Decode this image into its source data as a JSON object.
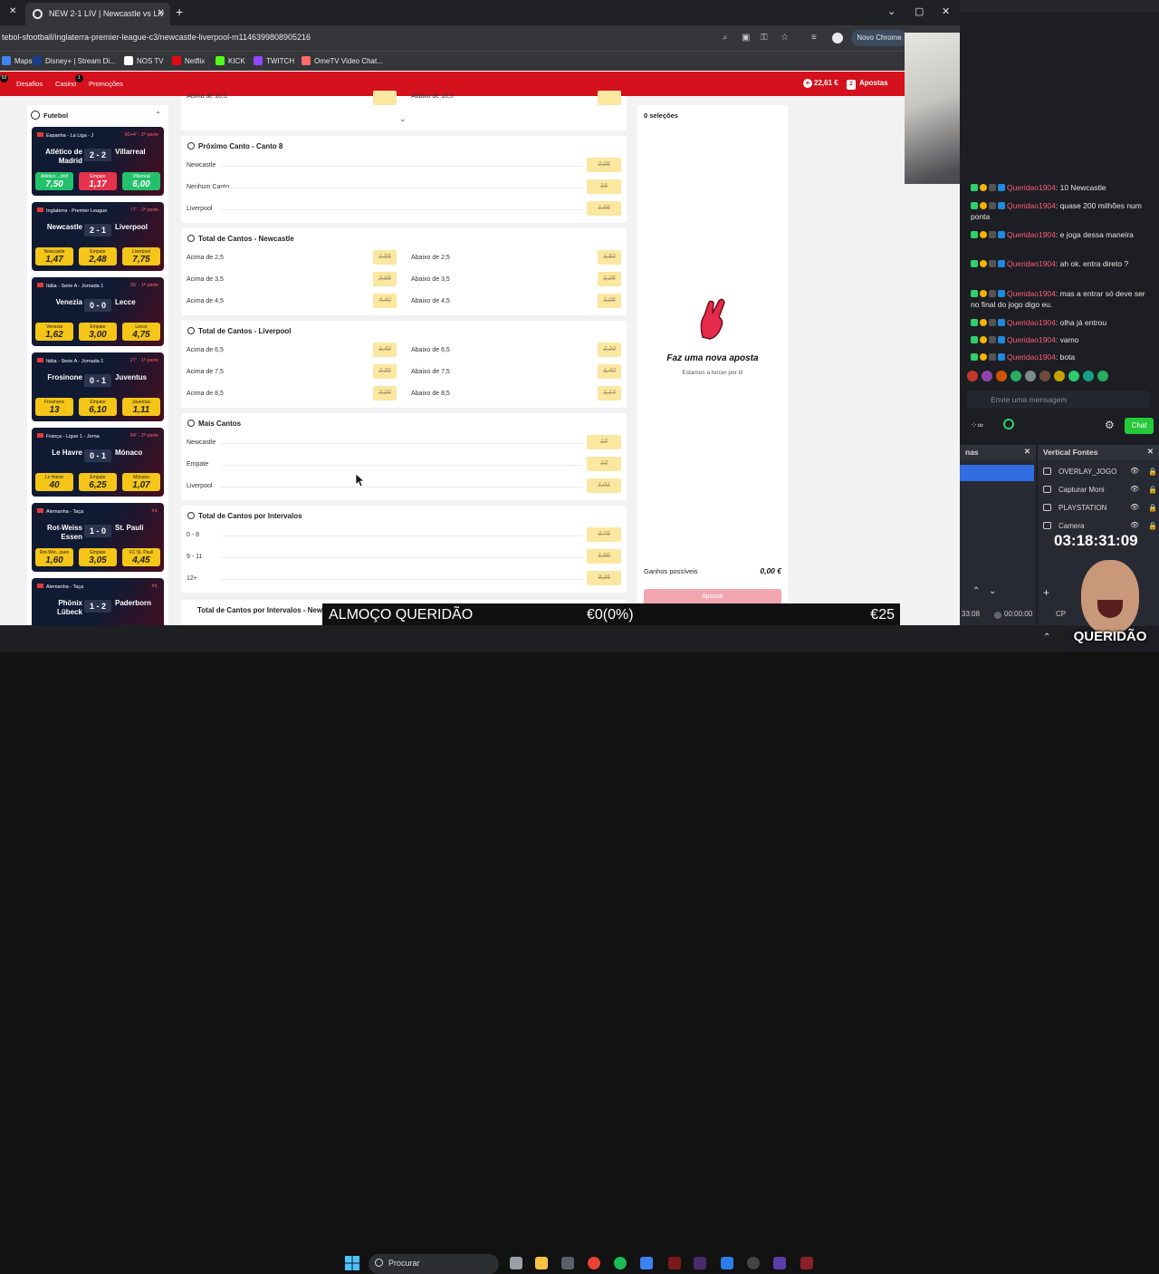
{
  "browser": {
    "tab_title": "NEW 2-1 LIV | Newcastle vs Liv",
    "url": "tebol-sfootball/inglaterra-premier-league-c3/newcastle-liverpool-m1146399808905216",
    "profile_button": "Novo Chrome",
    "bookmarks": [
      {
        "label": "Maps",
        "color": "#4285f4"
      },
      {
        "label": "Disney+ | Stream Di...",
        "color": "#1a3a8a"
      },
      {
        "label": "NOS TV",
        "color": "#ffffff"
      },
      {
        "label": "Netflix",
        "color": "#e50914"
      },
      {
        "label": "KICK",
        "color": "#53fc18"
      },
      {
        "label": "TWITCH",
        "color": "#9146ff"
      },
      {
        "label": "OmeTV Video Chat...",
        "color": "#ff6b6b"
      }
    ]
  },
  "site": {
    "nav": [
      {
        "label": "Desafios",
        "badge": "93"
      },
      {
        "label": "Casino",
        "badge": "1"
      },
      {
        "label": "Promoções",
        "badge": ""
      }
    ],
    "balance": "22,61 €",
    "bets_label": "Apostas",
    "bets_badge": "2",
    "accent": "#d4111c"
  },
  "sidebar": {
    "title": "Futebol",
    "matches": [
      {
        "league": "Espanha - La Liga - J",
        "time": "90+4' - 2ª parte",
        "home": "Atlético de Madrid",
        "away": "Villarreal",
        "score": "2 - 2",
        "live": true,
        "odds": [
          {
            "label": "Atlético ...drid",
            "value": "7,50"
          },
          {
            "label": "Empate",
            "value": "1,17"
          },
          {
            "label": "Villarreal",
            "value": "6,00"
          }
        ]
      },
      {
        "league": "Inglaterra - Premier League",
        "time": "77' - 2ª parte",
        "home": "Newcastle",
        "away": "Liverpool",
        "score": "2 - 1",
        "live": false,
        "odds": [
          {
            "label": "Newcastle",
            "value": "1,47"
          },
          {
            "label": "Empate",
            "value": "2,48"
          },
          {
            "label": "Liverpool",
            "value": "7,75"
          }
        ]
      },
      {
        "league": "Itália - Serie A - Jornada 1",
        "time": "26' - 1ª parte",
        "home": "Venezia",
        "away": "Lecce",
        "score": "0 - 0",
        "live": false,
        "odds": [
          {
            "label": "Venezia",
            "value": "1,62"
          },
          {
            "label": "Empate",
            "value": "3,00"
          },
          {
            "label": "Lecce",
            "value": "4,75"
          }
        ]
      },
      {
        "league": "Itália - Serie A - Jornada 1",
        "time": "27' - 1ª parte",
        "home": "Frosinone",
        "away": "Juventus",
        "score": "0 - 1",
        "live": false,
        "odds": [
          {
            "label": "Frosinone",
            "value": "13"
          },
          {
            "label": "Empate",
            "value": "6,10"
          },
          {
            "label": "Juventus",
            "value": "1,11"
          }
        ]
      },
      {
        "league": "França - Ligue 1 - Jorna",
        "time": "84' - 2ª parte",
        "home": "Le Havre",
        "away": "Mónaco",
        "score": "0 - 1",
        "live": false,
        "odds": [
          {
            "label": "Le Havre",
            "value": "40"
          },
          {
            "label": "Empate",
            "value": "6,25"
          },
          {
            "label": "Mónaco",
            "value": "1,07"
          }
        ]
      },
      {
        "league": "Alemanha - Taça",
        "time": "Int.",
        "home": "Rot-Weiss Essen",
        "away": "St. Pauli",
        "score": "1 - 0",
        "live": false,
        "odds": [
          {
            "label": "Rot-Wei...ssen",
            "value": "1,60"
          },
          {
            "label": "Empate",
            "value": "3,05"
          },
          {
            "label": "FC St. Pauli",
            "value": "4,45"
          }
        ]
      },
      {
        "league": "Alemanha - Taça",
        "time": "Int.",
        "home": "Phönix Lübeck",
        "away": "Paderborn",
        "score": "1 - 2",
        "live": false,
        "odds": []
      }
    ]
  },
  "markets": {
    "top_partial": {
      "left": "Acima de 10,5",
      "right": "Abaixo de 10,5"
    },
    "proximo_canto": {
      "title": "Próximo Canto - Canto 8",
      "rows": [
        {
          "label": "Newcastle",
          "odd": "2,05"
        },
        {
          "label": "Nenhum Canto",
          "odd": "16"
        },
        {
          "label": "Liverpool",
          "odd": "1,56"
        }
      ]
    },
    "total_newcastle": {
      "title": "Total de Cantos - Newcastle",
      "rows": [
        {
          "l": "Acima de 2,5",
          "lo": "1,55",
          "r": "Abaixo de 2,5",
          "ro": "1,82"
        },
        {
          "l": "Acima de 3,5",
          "lo": "2,65",
          "r": "Abaixo de 3,5",
          "ro": "1,25"
        },
        {
          "l": "Acima de 4,5",
          "lo": "4,40",
          "r": "Abaixo de 4,5",
          "ro": "1,05"
        }
      ]
    },
    "total_liverpool": {
      "title": "Total de Cantos - Liverpool",
      "rows": [
        {
          "l": "Acima de 6,5",
          "lo": "1,42",
          "r": "Abaixo de 6,5",
          "ro": "2,10"
        },
        {
          "l": "Acima de 7,5",
          "lo": "2,35",
          "r": "Abaixo de 7,5",
          "ro": "1,40"
        },
        {
          "l": "Acima de 8,5",
          "lo": "3,20",
          "r": "Abaixo de 8,5",
          "ro": "1,14"
        }
      ]
    },
    "mais_cantos": {
      "title": "Mais Cantos",
      "rows": [
        {
          "label": "Newcastle",
          "odd": "13"
        },
        {
          "label": "Empate",
          "odd": "13"
        },
        {
          "label": "Liverpool",
          "odd": "1,01"
        }
      ]
    },
    "por_intervalos": {
      "title": "Total de Cantos por Intervalos",
      "rows": [
        {
          "label": "0 - 8",
          "odd": "3,75"
        },
        {
          "label": "9 - 11",
          "odd": "1,60"
        },
        {
          "label": "12+",
          "odd": "3,25"
        }
      ]
    },
    "por_intervalos_next": {
      "title": "Total de Cantos por Intervalos - Newca"
    }
  },
  "betslip": {
    "selections": "0 seleções",
    "empty_title": "Faz uma nova aposta",
    "empty_subtitle": "Estamos a torcer por ti!",
    "winnings_label": "Ganhos possíveis",
    "winnings_value": "0,00 €",
    "place_bet": "Apostar"
  },
  "chat": {
    "messages": [
      {
        "user": "Queridao1904",
        "text": ": 10 Newcastle"
      },
      {
        "user": "Queridao1904",
        "text": ": quase 200 milhões num ponta"
      },
      {
        "user": "Queridao1904",
        "text": ": e joga dessa maneira"
      },
      {
        "user": "Queridao1904",
        "text": ": ah ok. entra direto ?"
      },
      {
        "user": "Queridao1904",
        "text": ": mas a entrar só deve ser no final do jogo digo eu."
      },
      {
        "user": "Queridao1904",
        "text": ": olha já entrou"
      },
      {
        "user": "Queridao1904",
        "text": ": vamo"
      },
      {
        "user": "Queridao1904",
        "text": ": bota"
      }
    ],
    "input_placeholder": "Envie uma mensagem",
    "chat_button": "Chat"
  },
  "obs": {
    "scenes_title": "nas",
    "sources_title": "Vertical Fontes",
    "sources": [
      "OVERLAY_JOGO",
      "Capturar Moni",
      "PLAYSTATION",
      "Camera"
    ],
    "timer": "03:18:31:09",
    "time_left": "33:08",
    "time_right": "00:00:00",
    "cpu": "CP"
  },
  "overlay": {
    "left": "ALMOÇO QUERIDÃO",
    "middle": "€0(0%)",
    "right": "€25"
  },
  "facecam_logo": "QUERIDÃO",
  "taskbar": {
    "search": "Procurar"
  }
}
